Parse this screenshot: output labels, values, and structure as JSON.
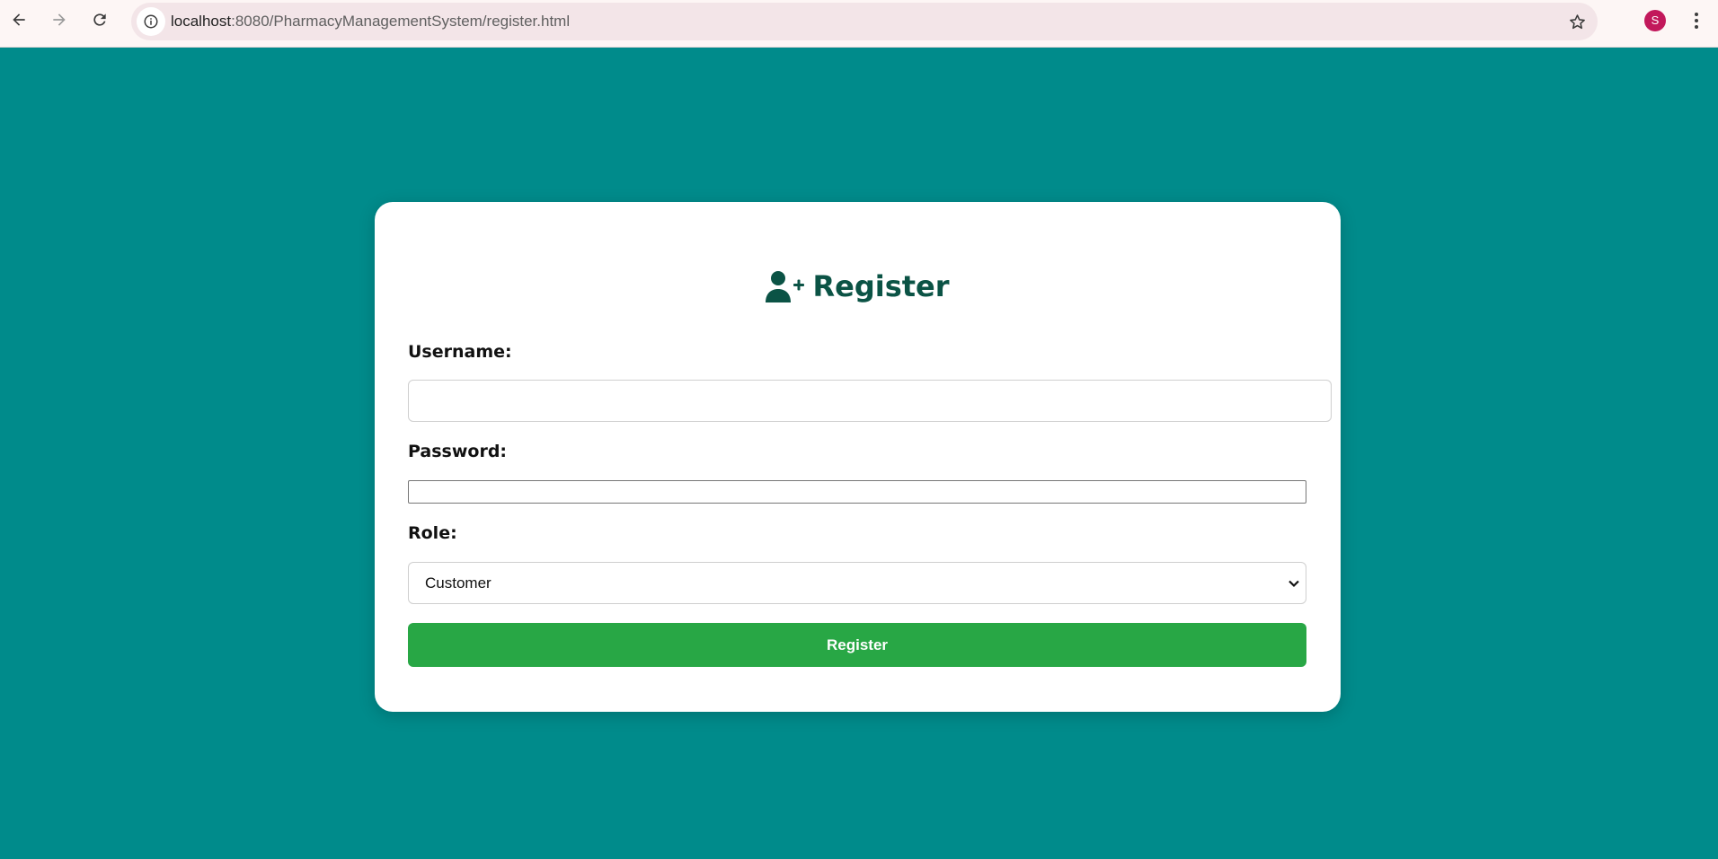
{
  "browser": {
    "url_host": "localhost",
    "url_path": ":8080/PharmacyManagementSystem/register.html",
    "profile_initial": "S",
    "profile_color": "#c2185b"
  },
  "form": {
    "title": "Register",
    "title_icon": "user-plus-icon",
    "username_label": "Username:",
    "username_value": "",
    "password_label": "Password:",
    "password_value": "",
    "role_label": "Role:",
    "role_selected": "Customer",
    "submit_label": "Register"
  },
  "colors": {
    "page_background": "#008b8b",
    "title_color": "#0b5345",
    "button_color": "#28a745"
  }
}
